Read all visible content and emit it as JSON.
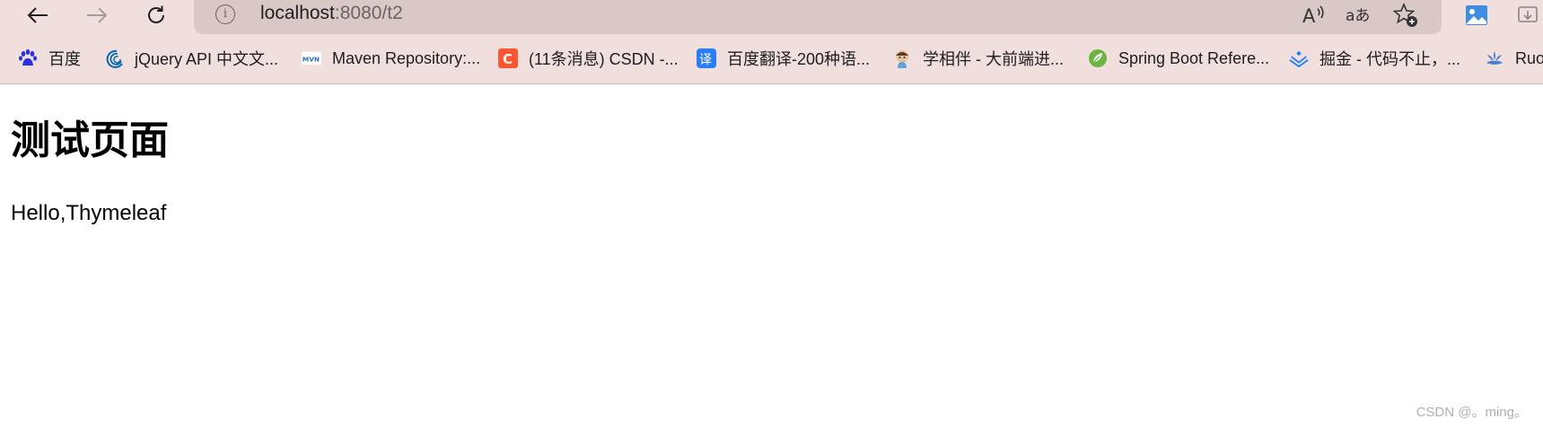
{
  "browser": {
    "address": {
      "host": "localhost",
      "rest": ":8080/t2"
    },
    "info_icon_glyph": "i",
    "bookmarks": [
      {
        "icon": "baidu-paw-icon",
        "label": "百度"
      },
      {
        "icon": "jquery-icon",
        "label": "jQuery API 中文文..."
      },
      {
        "icon": "maven-icon",
        "label": "Maven Repository:..."
      },
      {
        "icon": "csdn-icon",
        "label": "(11条消息) CSDN -..."
      },
      {
        "icon": "baidu-translate-icon",
        "label": "百度翻译-200种语..."
      },
      {
        "icon": "avatar-icon",
        "label": "学相伴 - 大前端进..."
      },
      {
        "icon": "spring-icon",
        "label": "Spring Boot Refere..."
      },
      {
        "icon": "juejin-icon",
        "label": "掘金 - 代码不止，..."
      },
      {
        "icon": "ruoyi-icon",
        "label": "Ruo"
      }
    ],
    "icon_glyphs": {
      "maven": "MVN",
      "csdn": "C",
      "translate": "译",
      "read_aloud": "A",
      "translate_page": "aあ"
    }
  },
  "page": {
    "title": "测试页面",
    "text": "Hello,Thymeleaf"
  },
  "watermark": "CSDN @。ming。",
  "colors": {
    "chrome_bg": "#f0dfdd",
    "address_bg": "#d9c8c6",
    "csdn": "#fc5531",
    "translate": "#2b7df2",
    "spring": "#6db33f",
    "juejin": "#1e80ff",
    "jquery": "#0769ad"
  }
}
